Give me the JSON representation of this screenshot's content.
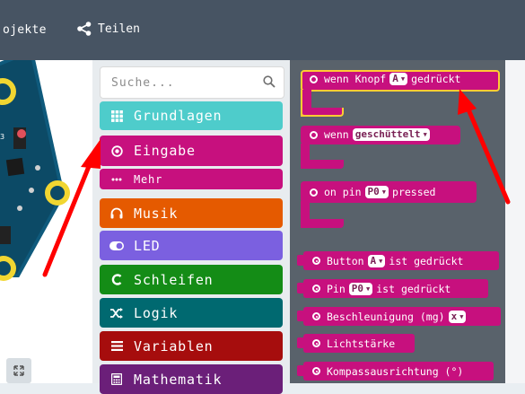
{
  "topbar": {
    "projects_label": "ojekte",
    "share_label": "Teilen"
  },
  "toolbox": {
    "search_placeholder": "Suche...",
    "categories": [
      {
        "label": "Grundlagen",
        "icon": "grid-icon",
        "color": "#4ecccb"
      },
      {
        "label": "Eingabe",
        "icon": "radio-button-icon",
        "color": "#c7107e"
      },
      {
        "label": "Mehr",
        "icon": "ellipsis-icon",
        "color": "#c7107e"
      },
      {
        "label": "Musik",
        "icon": "headphones-icon",
        "color": "#e55a00"
      },
      {
        "label": "LED",
        "icon": "toggle-icon",
        "color": "#7b60e0"
      },
      {
        "label": "Schleifen",
        "icon": "loop-icon",
        "color": "#148c16"
      },
      {
        "label": "Logik",
        "icon": "shuffle-icon",
        "color": "#006970"
      },
      {
        "label": "Variablen",
        "icon": "list-icon",
        "color": "#a60d0d"
      },
      {
        "label": "Mathematik",
        "icon": "calculator-icon",
        "color": "#6b1f79"
      }
    ]
  },
  "blocks": {
    "button_event": {
      "text_before": "wenn Knopf",
      "option": "A",
      "text_after": "gedrückt"
    },
    "shake_event": {
      "text_before": "wenn",
      "option": "geschüttelt"
    },
    "pin_event": {
      "text_before": "on pin",
      "option": "P0",
      "text_after": "pressed"
    },
    "button_pressed": {
      "text_before": "Button",
      "option": "A",
      "text_after": "ist gedrückt"
    },
    "pin_pressed": {
      "text_before": "Pin",
      "option": "P0",
      "text_after": "ist gedrückt"
    },
    "acceleration": {
      "text_before": "Beschleunigung (mg)",
      "option": "x"
    },
    "light_level": {
      "text": "Lichtstärke"
    },
    "compass": {
      "text": "Kompassausrichtung (°)"
    }
  },
  "colors": {
    "input_category": "#c7107e",
    "highlight": "#ffcc33",
    "arrow": "#ff0000",
    "workspace": "#59626b",
    "topbar": "#475463"
  }
}
